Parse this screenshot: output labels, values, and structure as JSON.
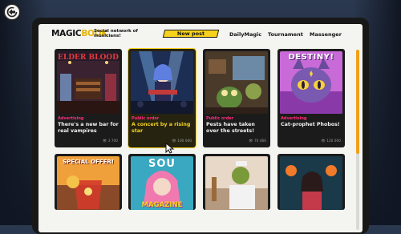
{
  "header": {
    "logo_magic": "MAGIC",
    "logo_book": "BOOK",
    "tagline": "Social network of musicians!",
    "new_post": "New post",
    "nav": [
      "DailyMagic",
      "Tournament",
      "Massenger"
    ]
  },
  "cards": [
    {
      "art_text": "ELDER BLOOD",
      "category": "Advertising",
      "title": "There's a new bar for real vampires",
      "views": "3 700"
    },
    {
      "art_text": "",
      "category": "Public order",
      "title": "A concert by a rising star",
      "views": "100 000"
    },
    {
      "art_text": "",
      "category": "Public order",
      "title": "Pests have taken over the streets!",
      "views": "70 460"
    },
    {
      "art_text": "DESTINY!",
      "category": "Advertising",
      "title": "Cat-prophet Phobos!",
      "views": "120 000"
    }
  ],
  "cards_row2": [
    {
      "art_text": "SPECIAL OFFER!"
    },
    {
      "art_text_top": "SOU",
      "art_text_bottom": "MAGAZINE"
    },
    {
      "art_text": ""
    },
    {
      "art_text": ""
    }
  ],
  "colors": {
    "accent_yellow": "#f7d21c",
    "category_pink": "#ff2d7a",
    "scroll_orange": "#f0a019"
  },
  "icons": [
    "back-arrow-icon",
    "eye-icon",
    "pointer-cursor-icon"
  ]
}
